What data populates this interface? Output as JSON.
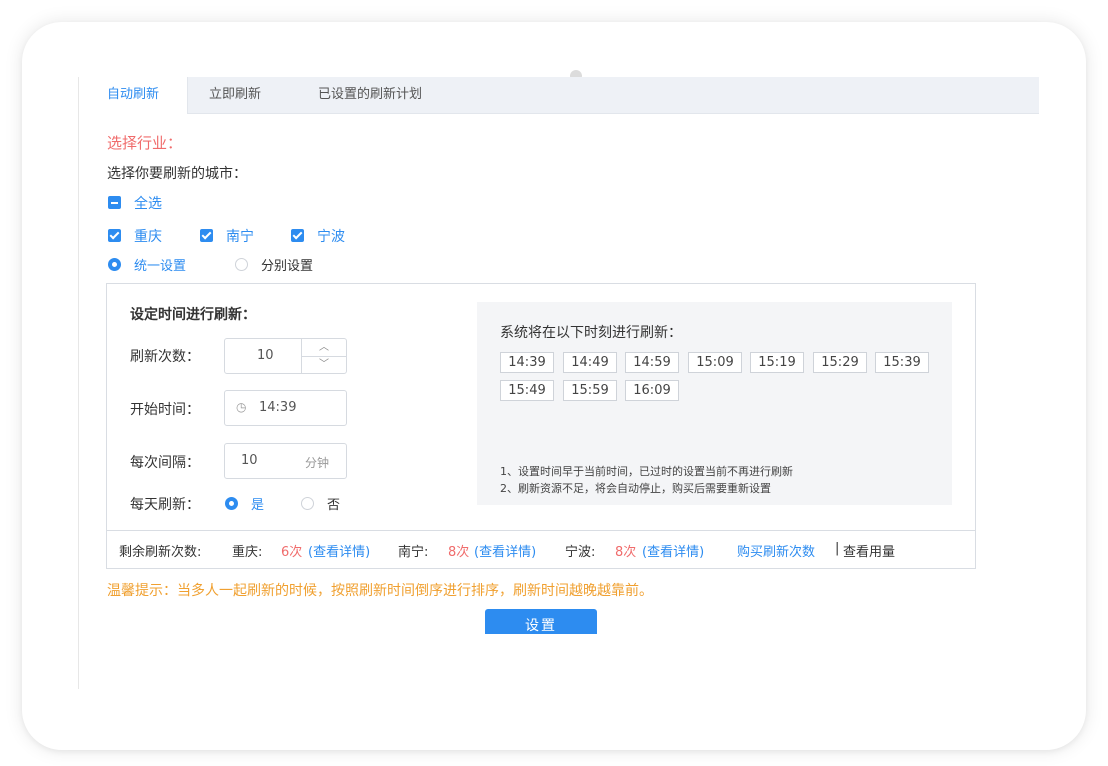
{
  "tabs": [
    "自动刷新",
    "立即刷新",
    "已设置的刷新计划"
  ],
  "industry_label": "选择行业：",
  "city_prompt": "选择你要刷新的城市：",
  "select_all": "全选",
  "cities": [
    "重庆",
    "南宁",
    "宁波"
  ],
  "mode_options": [
    "统一设置",
    "分别设置"
  ],
  "panel": {
    "title": "设定时间进行刷新：",
    "count_label": "刷新次数：",
    "count_value": "10",
    "start_label": "开始时间：",
    "start_value": "14:39",
    "interval_label": "每次间隔：",
    "interval_value": "10",
    "interval_unit": "分钟",
    "daily_label": "每天刷新：",
    "daily_yes": "是",
    "daily_no": "否",
    "schedule_title": "系统将在以下时刻进行刷新：",
    "times": [
      "14:39",
      "14:49",
      "14:59",
      "15:09",
      "15:19",
      "15:29",
      "15:39",
      "15:49",
      "15:59",
      "16:09"
    ],
    "notes": [
      "1、设置时间早于当前时间，已过时的设置当前不再进行刷新",
      "2、刷新资源不足，将会自动停止，购买后需要重新设置"
    ]
  },
  "footer": {
    "remaining_label": "剩余刷新次数:",
    "entries": [
      {
        "city": "重庆:",
        "count": "6次",
        "link": "(查看详情)"
      },
      {
        "city": "南宁:",
        "count": "8次",
        "link": "(查看详情)"
      },
      {
        "city": "宁波:",
        "count": "8次",
        "link": "(查看详情)"
      }
    ],
    "buy_link": "购买刷新次数",
    "separator": "|",
    "usage_link": "查看用量"
  },
  "tip": "温馨提示：当多人一起刷新的时候，按照刷新时间倒序进行排序，刷新时间越晚越靠前。",
  "submit_button": "设置",
  "colors": {
    "accent": "#2d8cf0",
    "red": "#f06c6c",
    "tip": "#f0a030"
  }
}
